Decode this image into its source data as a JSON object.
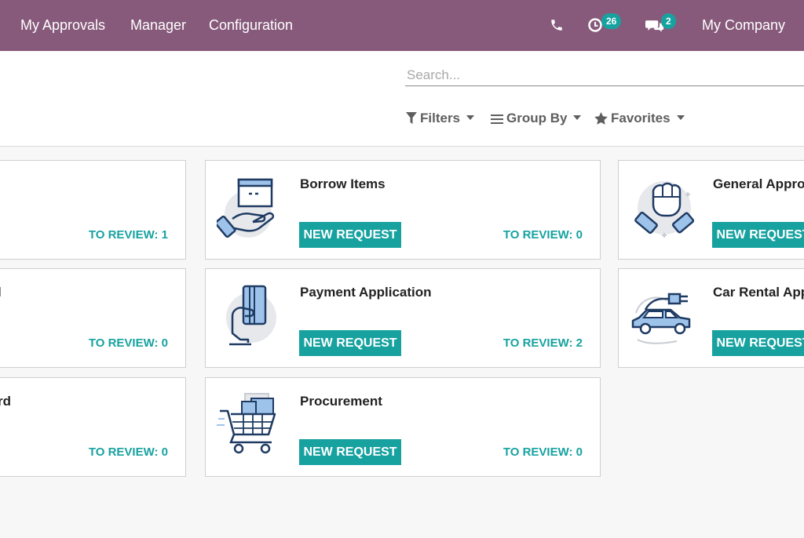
{
  "navbar": {
    "menu": [
      "My Approvals",
      "Manager",
      "Configuration"
    ],
    "activity_badge": "26",
    "messages_badge": "2",
    "company": "My Company",
    "icons": [
      "phone-icon",
      "clock-icon",
      "chat-icon"
    ]
  },
  "search": {
    "placeholder": "Search..."
  },
  "controls": {
    "filters": "Filters",
    "group_by": "Group By",
    "favorites": "Favorites"
  },
  "cards": [
    {
      "title": "",
      "new_request": "",
      "review_label": "TO REVIEW:",
      "review_count": "1",
      "icon": ""
    },
    {
      "title": "Borrow Items",
      "new_request": "NEW REQUEST",
      "review_label": "TO REVIEW:",
      "review_count": "0",
      "icon": "box-in-hand-icon"
    },
    {
      "title": "General Approv",
      "new_request": "NEW REQUEST",
      "review_label": "",
      "review_count": "",
      "icon": "raised-fist-icon"
    },
    {
      "title": "l",
      "new_request": "",
      "review_label": "TO REVIEW:",
      "review_count": "0",
      "icon": ""
    },
    {
      "title": "Payment Application",
      "new_request": "NEW REQUEST",
      "review_label": "TO REVIEW:",
      "review_count": "2",
      "icon": "credit-card-in-hand-icon"
    },
    {
      "title": "Car Rental App",
      "new_request": "NEW REQUEST",
      "review_label": "",
      "review_count": "",
      "icon": "electric-car-icon"
    },
    {
      "title": "rd",
      "new_request": "",
      "review_label": "TO REVIEW:",
      "review_count": "0",
      "icon": ""
    },
    {
      "title": "Procurement",
      "new_request": "NEW REQUEST",
      "review_label": "TO REVIEW:",
      "review_count": "0",
      "icon": "shopping-cart-icon"
    }
  ],
  "colors": {
    "navbar": "#875a7b",
    "accent": "#17a2a0",
    "background": "#f7f7f7"
  }
}
